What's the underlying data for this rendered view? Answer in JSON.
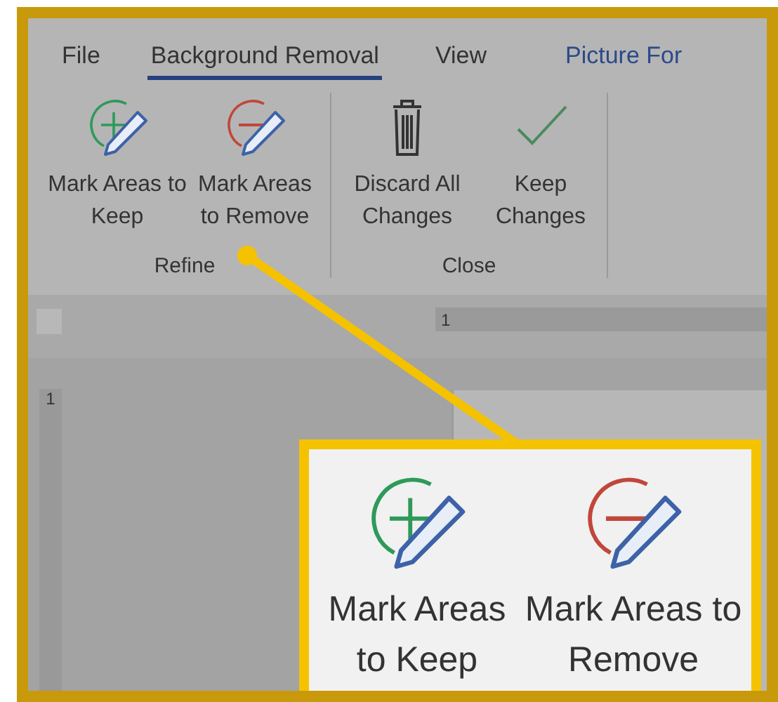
{
  "tabs": [
    {
      "label": "File",
      "selected": false
    },
    {
      "label": "Background Removal",
      "selected": true
    },
    {
      "label": "View",
      "selected": false
    },
    {
      "label": "Picture For",
      "selected": false
    }
  ],
  "groups": [
    {
      "label": "Refine",
      "buttons": [
        {
          "kind": "keep",
          "label": "Mark Areas to Keep"
        },
        {
          "kind": "remove",
          "label": "Mark Areas to Remove"
        }
      ]
    },
    {
      "label": "Close",
      "buttons": [
        {
          "kind": "discard",
          "label": "Discard All Changes"
        },
        {
          "kind": "accept",
          "label": "Keep Changes"
        }
      ]
    }
  ],
  "ruler": {
    "horizontal_label": "1",
    "vertical_label": "1"
  },
  "callout": {
    "buttons": [
      {
        "kind": "keep",
        "label": "Mark Areas to Keep"
      },
      {
        "kind": "remove",
        "label": "Mark Areas to Remove"
      }
    ]
  }
}
